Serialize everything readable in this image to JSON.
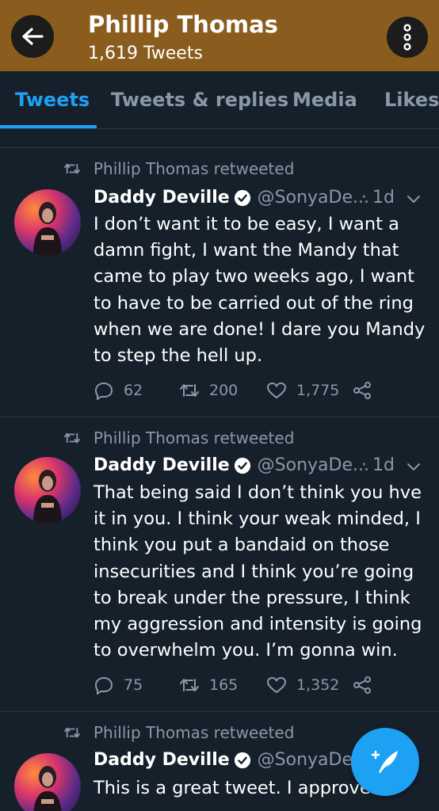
{
  "header": {
    "title": "Phillip Thomas",
    "subtitle": "1,619 Tweets",
    "back_icon": "arrow-left-icon",
    "more_icon": "vertical-dots-icon",
    "background_color": "#8a5d1e"
  },
  "tabs": [
    {
      "label": "Tweets",
      "active": true
    },
    {
      "label": "Tweets & replies",
      "active": false
    },
    {
      "label": "Media",
      "active": false
    },
    {
      "label": "Likes",
      "active": false
    }
  ],
  "colors": {
    "background": "#15202b",
    "accent": "#1da1f2",
    "muted_text": "#8899a6"
  },
  "tweets": [
    {
      "retweeted_by": "Phillip Thomas retweeted",
      "name": "Daddy Deville",
      "handle": "@SonyaDe...",
      "time": "· 1d",
      "text": "I don’t want it to be easy, I want a damn fight, I want the Mandy that came to play two weeks ago, I want to have to be carried out of the ring when we are done! I dare you Mandy to step the hell up.",
      "replies": "62",
      "retweets": "200",
      "likes": "1,775"
    },
    {
      "retweeted_by": "Phillip Thomas retweeted",
      "name": "Daddy Deville",
      "handle": "@SonyaDe...",
      "time": "· 1d",
      "text": "That being said I don’t think you hve it in you. I think your weak minded, I think you put a bandaid on those insecurities and I think you’re going to break under the pressure, I think my aggression and intensity is going to overwhelm you. I’m gonna win.",
      "replies": "75",
      "retweets": "165",
      "likes": "1,352"
    },
    {
      "retweeted_by": "Phillip Thomas retweeted",
      "name": "Daddy Deville",
      "handle": "@SonyaDe...",
      "text": "This is a great tweet. I approve"
    }
  ],
  "fab": {
    "icon": "compose-feather-icon"
  }
}
